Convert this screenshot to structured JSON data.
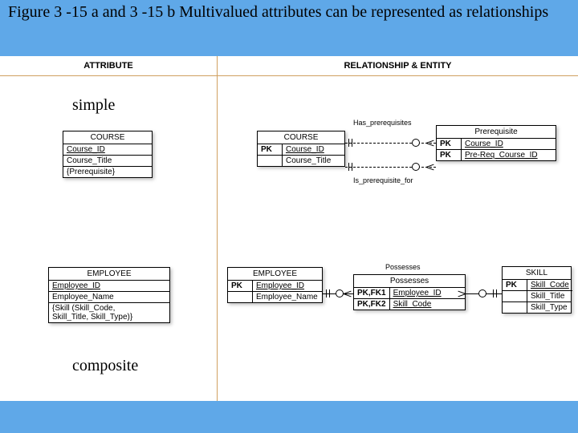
{
  "title": "Figure 3 -15 a and 3 -15 b Multivalued attributes can be represented as relationships",
  "headers": {
    "left": "ATTRIBUTE",
    "right": "RELATIONSHIP & ENTITY"
  },
  "labels": {
    "simple": "simple",
    "composite": "composite"
  },
  "rel_labels": {
    "has_prereq": "Has_prerequisites",
    "is_prereq": "Is_prerequisite_for",
    "possesses": "Possesses"
  },
  "entities": {
    "course_attr": {
      "name": "COURSE",
      "rows": [
        {
          "l": "",
          "v": "Course_ID",
          "ul": true
        },
        {
          "l": "",
          "v": "Course_Title"
        },
        {
          "l": "",
          "v": "{Prerequisite}"
        }
      ]
    },
    "course_rel": {
      "name": "COURSE",
      "rows": [
        {
          "l": "PK",
          "v": "Course_ID",
          "ul": true
        },
        {
          "l": "",
          "v": "Course_Title"
        }
      ]
    },
    "prereq": {
      "name": "Prerequisite",
      "rows": [
        {
          "l": "PK",
          "v": "Course_ID",
          "ul": true
        },
        {
          "l": "PK",
          "v": "Pre-Req_Course_ID",
          "ul": true
        }
      ]
    },
    "employee_attr": {
      "name": "EMPLOYEE",
      "rows": [
        {
          "l": "",
          "v": "Employee_ID",
          "ul": true
        },
        {
          "l": "",
          "v": "Employee_Name"
        },
        {
          "l": "",
          "v": "{Skill (Skill_Code,\nSkill_Title, Skill_Type)}"
        }
      ]
    },
    "employee_rel": {
      "name": "EMPLOYEE",
      "rows": [
        {
          "l": "PK",
          "v": "Employee_ID",
          "ul": true
        },
        {
          "l": "",
          "v": "Employee_Name"
        }
      ]
    },
    "possesses": {
      "name": "Possesses",
      "rows": [
        {
          "l": "PK,FK1",
          "v": "Employee_ID",
          "ul": true
        },
        {
          "l": "PK,FK2",
          "v": "Skill_Code",
          "ul": true
        }
      ]
    },
    "skill": {
      "name": "SKILL",
      "rows": [
        {
          "l": "PK",
          "v": "Skill_Code",
          "ul": true
        },
        {
          "l": "",
          "v": "Skill_Title"
        },
        {
          "l": "",
          "v": "Skill_Type"
        }
      ]
    }
  }
}
